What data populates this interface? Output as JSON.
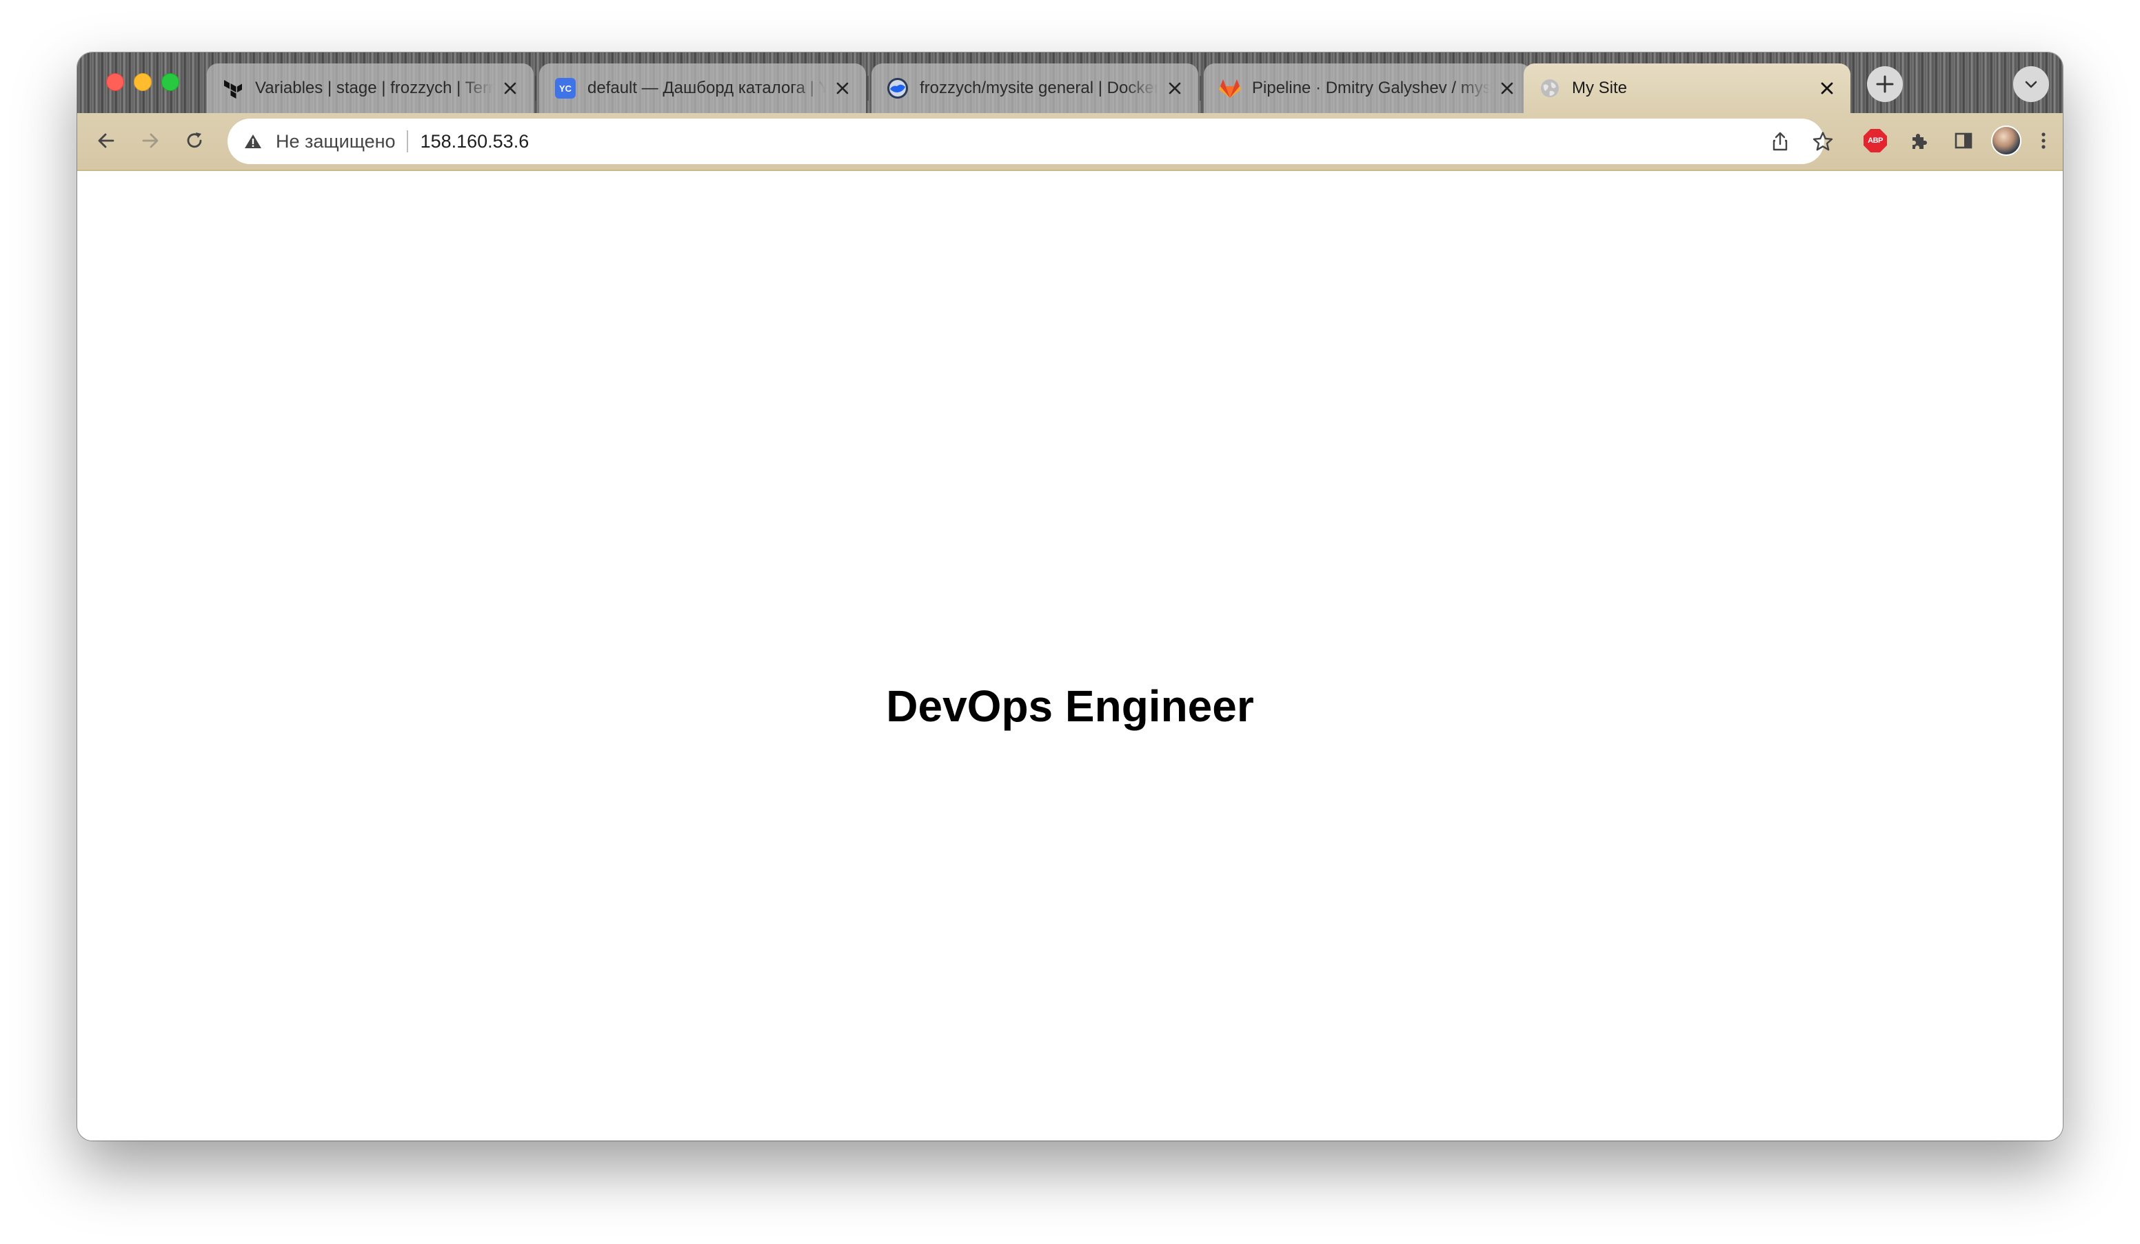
{
  "browser": {
    "tabs": [
      {
        "title": "Variables | stage | frozzych | Terraform",
        "favicon": "terraform-icon",
        "active": false
      },
      {
        "title": "default — Дашборд каталога | Yandex Cloud",
        "favicon": "yandex-cloud-icon",
        "active": false
      },
      {
        "title": "frozzych/mysite general | Docker Hub",
        "favicon": "docker-icon",
        "active": false
      },
      {
        "title": "Pipeline · Dmitry Galyshev / mysite · GitLab",
        "favicon": "gitlab-icon",
        "active": false
      },
      {
        "title": "My Site",
        "favicon": "globe-icon",
        "active": true
      }
    ],
    "address_bar": {
      "security_label": "Не защищено",
      "url": "158.160.53.6"
    },
    "extensions": {
      "abp_label": "ABP"
    },
    "favicon_text": {
      "yandex_cloud": "YC"
    }
  },
  "page": {
    "headline": "DevOps Engineer"
  },
  "colors": {
    "toolbar": "#dccfb0",
    "active_tab": "#e4d8bd",
    "abp_red": "#e2252f",
    "gitlab_orange": "#fc6d26",
    "docker_blue": "#1d63ed",
    "yc_blue": "#3f73e8"
  }
}
